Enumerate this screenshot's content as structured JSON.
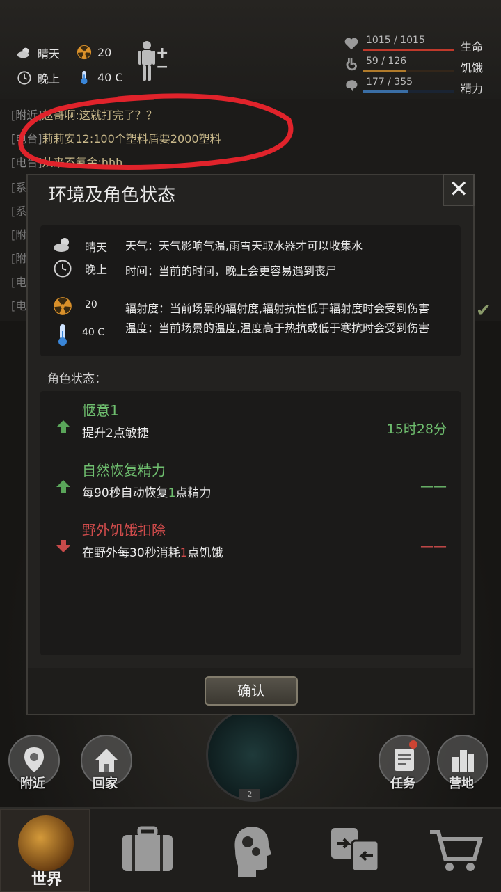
{
  "hud": {
    "weather": "晴天",
    "time_of_day": "晚上",
    "radiation": "20",
    "temperature": "40 C",
    "stats": [
      {
        "value": "1015 / 1015",
        "label": "生命",
        "fraction": 1.0,
        "color": "#c0392b"
      },
      {
        "value": "59 / 126",
        "label": "饥饿",
        "fraction": 0.47,
        "color": "#b07a2a"
      },
      {
        "value": "177 / 355",
        "label": "精力",
        "fraction": 0.5,
        "color": "#3a6ea5"
      }
    ]
  },
  "chat": [
    {
      "channel": "[附近]",
      "text": "赵哥啊:这就打完了？？"
    },
    {
      "channel": "[电台]",
      "text": "莉莉安12:100个塑料盾要2000塑料"
    },
    {
      "channel": "[电台]",
      "text": "从来不氪金:hhh"
    },
    {
      "channel": "[系",
      "text": ""
    },
    {
      "channel": "[系",
      "text": ""
    },
    {
      "channel": "[附",
      "text": ""
    },
    {
      "channel": "[附",
      "text": ""
    },
    {
      "channel": "[电",
      "text": ""
    },
    {
      "channel": "[电",
      "text": ""
    }
  ],
  "dialog": {
    "title": "环境及角色状态",
    "env": {
      "weather_value": "晴天",
      "weather_desc": "天气：天气影响气温,雨雪天取水器才可以收集水",
      "time_value": "晚上",
      "time_desc": "时间：当前的时间，晚上会更容易遇到丧尸",
      "radiation_value": "20",
      "radiation_desc": "辐射度：当前场景的辐射度,辐射抗性低于辐射度时会受到伤害",
      "temp_value": "40 C",
      "temp_desc": "温度：当前场景的温度,温度高于热抗或低于寒抗时会受到伤害"
    },
    "status_heading": "角色状态：",
    "statuses": [
      {
        "title": "惬意1",
        "desc_a": "提升2点敏捷",
        "desc_num": "",
        "desc_b": "",
        "time": "15时28分",
        "type": "buff"
      },
      {
        "title": "自然恢复精力",
        "desc_a": "每90秒自动恢复",
        "desc_num": "1",
        "desc_b": "点精力",
        "time": "——",
        "type": "buff"
      },
      {
        "title": "野外饥饿扣除",
        "desc_a": "在野外每30秒消耗",
        "desc_num": "1",
        "desc_b": "点饥饿",
        "time": "——",
        "type": "debuff"
      }
    ],
    "confirm_label": "确认"
  },
  "scene": {
    "nearby_label": "附近",
    "home_label": "回家",
    "task_label": "任务",
    "camp_label": "营地",
    "radar_badge": "2"
  },
  "tabs": {
    "world_label": "世界"
  }
}
